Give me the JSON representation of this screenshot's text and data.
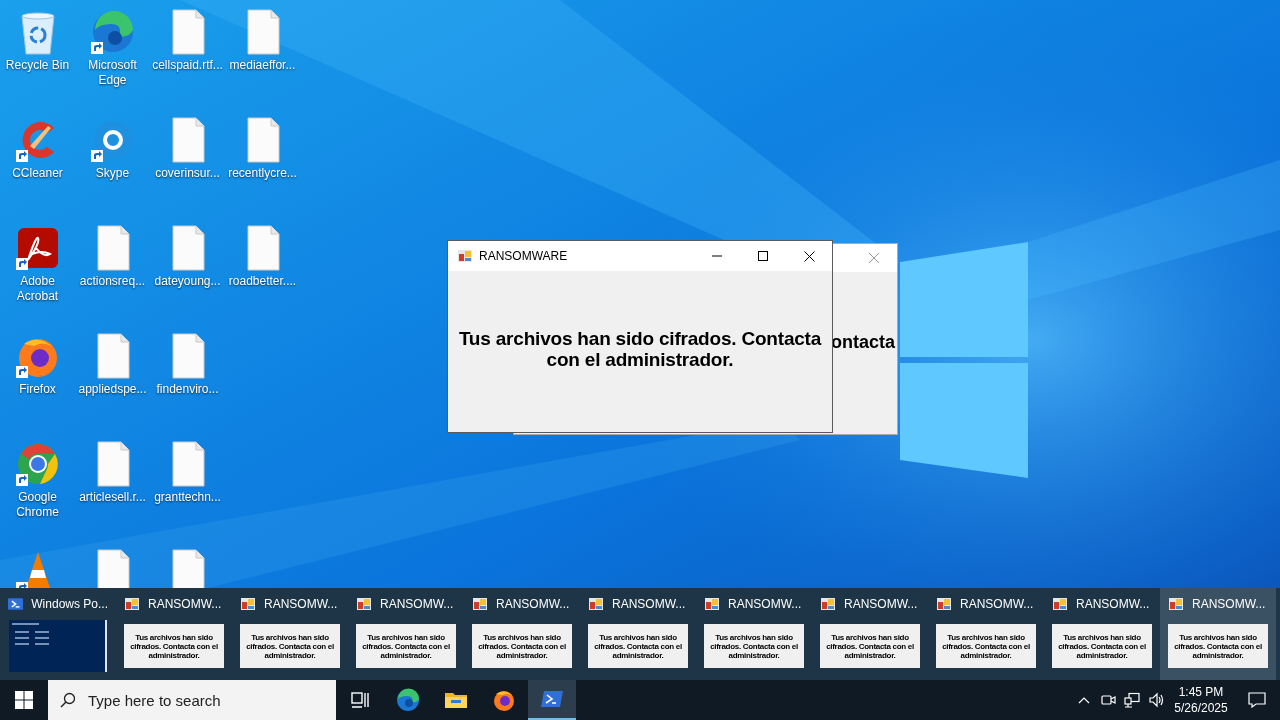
{
  "desktop": {
    "icon_columns": [
      [
        {
          "kind": "recycle",
          "label": "Recycle Bin",
          "shortcut": false
        },
        {
          "kind": "ccleaner",
          "label": "CCleaner",
          "shortcut": true
        },
        {
          "kind": "acrobat",
          "label": "Adobe Acrobat",
          "shortcut": true
        },
        {
          "kind": "firefox",
          "label": "Firefox",
          "shortcut": true
        },
        {
          "kind": "chrome",
          "label": "Google Chrome",
          "shortcut": true
        },
        {
          "kind": "vlc",
          "shortcut": true
        }
      ],
      [
        {
          "kind": "edge",
          "label": "Microsoft Edge",
          "shortcut": true
        },
        {
          "kind": "skype",
          "label": "Skype",
          "shortcut": true
        },
        {
          "kind": "file",
          "label": "actionsreq...",
          "shortcut": false
        },
        {
          "kind": "file",
          "label": "appliedspe...",
          "shortcut": false
        },
        {
          "kind": "file",
          "label": "articlesell.r...",
          "shortcut": false
        },
        {
          "kind": "file",
          "shortcut": false
        }
      ],
      [
        {
          "kind": "file",
          "label": "cellspaid.rtf...",
          "shortcut": false
        },
        {
          "kind": "file",
          "label": "coverinsur...",
          "shortcut": false
        },
        {
          "kind": "file",
          "label": "dateyoung...",
          "shortcut": false
        },
        {
          "kind": "file",
          "label": "findenviro...",
          "shortcut": false
        },
        {
          "kind": "file",
          "label": "granttechn...",
          "shortcut": false
        },
        {
          "kind": "file",
          "shortcut": false
        }
      ],
      [
        {
          "kind": "file",
          "label": "mediaeffor...",
          "shortcut": false
        },
        {
          "kind": "file",
          "label": "recentlycre...",
          "shortcut": false
        },
        {
          "kind": "file",
          "label": "roadbetter....",
          "shortcut": false
        }
      ]
    ]
  },
  "windows": [
    {
      "kind": "front",
      "title": "RANSOMWARE",
      "message": "Tus archivos han sido cifrados. Contacta con el administrador."
    },
    {
      "kind": "back",
      "message": "ontacta"
    }
  ],
  "thumbnails": [
    {
      "kind": "powershell",
      "title": "Windows Po...",
      "selected": false
    },
    {
      "kind": "dialog",
      "title": "RANSOMW...",
      "message": "Tus archivos han sido cifrados. Contacta con el administrador.",
      "selected": false
    },
    {
      "kind": "dialog",
      "title": "RANSOMW...",
      "message": "Tus archivos han sido cifrados. Contacta con el administrador.",
      "selected": false
    },
    {
      "kind": "dialog",
      "title": "RANSOMW...",
      "message": "Tus archivos han sido cifrados. Contacta con el administrador.",
      "selected": false
    },
    {
      "kind": "dialog",
      "title": "RANSOMW...",
      "message": "Tus archivos han sido cifrados. Contacta con el administrador.",
      "selected": false
    },
    {
      "kind": "dialog",
      "title": "RANSOMW...",
      "message": "Tus archivos han sido cifrados. Contacta con el administrador.",
      "selected": false
    },
    {
      "kind": "dialog",
      "title": "RANSOMW...",
      "message": "Tus archivos han sido cifrados. Contacta con el administrador.",
      "selected": false
    },
    {
      "kind": "dialog",
      "title": "RANSOMW...",
      "message": "Tus archivos han sido cifrados. Contacta con el administrador.",
      "selected": false
    },
    {
      "kind": "dialog",
      "title": "RANSOMW...",
      "message": "Tus archivos han sido cifrados. Contacta con el administrador.",
      "selected": false
    },
    {
      "kind": "dialog",
      "title": "RANSOMW...",
      "message": "Tus archivos han sido cifrados. Contacta con el administrador.",
      "selected": false
    },
    {
      "kind": "dialog",
      "title": "RANSOMW...",
      "message": "Tus archivos han sido cifrados. Contacta con el administrador.",
      "selected": true
    }
  ],
  "taskbar": {
    "search": {
      "placeholder": "Type here to search"
    },
    "apps": [
      {
        "kind": "taskview",
        "active": false
      },
      {
        "kind": "edge",
        "active": false
      },
      {
        "kind": "explorer",
        "active": false
      },
      {
        "kind": "firefox",
        "active": false
      },
      {
        "kind": "powershell",
        "active": true
      }
    ],
    "tray": {
      "time": "1:45 PM",
      "date": "5/26/2025"
    }
  }
}
